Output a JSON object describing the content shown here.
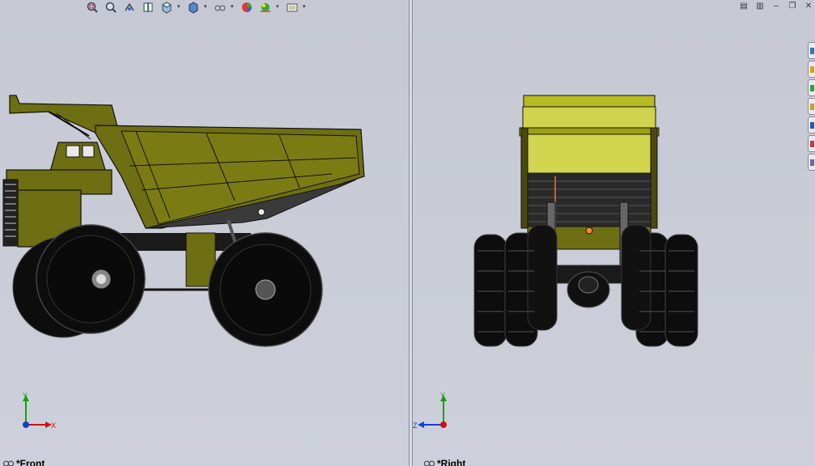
{
  "toolbar": {
    "items": [
      {
        "icon": "zoom-to-fit-icon",
        "dropdown": false
      },
      {
        "icon": "zoom-to-area-icon",
        "dropdown": false
      },
      {
        "icon": "previous-view-icon",
        "dropdown": false
      },
      {
        "icon": "section-view-icon",
        "dropdown": false
      },
      {
        "icon": "view-orientation-icon",
        "dropdown": true
      },
      {
        "icon": "display-style-icon",
        "dropdown": true
      },
      {
        "icon": "hide-show-items-icon",
        "dropdown": true
      },
      {
        "icon": "edit-appearance-icon",
        "dropdown": false
      },
      {
        "icon": "apply-scene-icon",
        "dropdown": true
      },
      {
        "icon": "view-settings-icon",
        "dropdown": true
      }
    ],
    "dropdown_glyph": "▾"
  },
  "window_controls": [
    "tile-horizontal-icon",
    "tile-vertical-icon",
    "minimize-icon",
    "restore-icon",
    "close-icon"
  ],
  "window_glyphs": {
    "minimize": "–",
    "restore": "❐",
    "close": "✕",
    "tile_h": "▤",
    "tile_v": "▥"
  },
  "task_pane": {
    "tabs": [
      "resources-tab-icon",
      "design-library-tab-icon",
      "file-explorer-tab-icon",
      "view-palette-tab-icon",
      "appearances-tab-icon",
      "custom-properties-tab-icon",
      "solidworks-forum-tab-icon"
    ],
    "colors": [
      "#3a70c8",
      "#d8a020",
      "#3a9a3a",
      "#c8a020",
      "#2a5aa8",
      "#c04040",
      "#6a6aa0"
    ]
  },
  "viewports": {
    "front": {
      "label": "*Front",
      "triad": {
        "vertical": "Y",
        "horizontal": "X"
      }
    },
    "right": {
      "label": "*Right",
      "triad": {
        "vertical": "Y",
        "horizontal": "Z"
      }
    }
  },
  "colors": {
    "body": "#6e6e12",
    "body_light": "#8a8a1a",
    "bed_right": "#cfd24c",
    "bed_right_dark": "#9ea012",
    "tire": "#0d0d0d",
    "axis_x": "#d01010",
    "axis_y": "#10a010",
    "axis_z": "#1040d0"
  }
}
